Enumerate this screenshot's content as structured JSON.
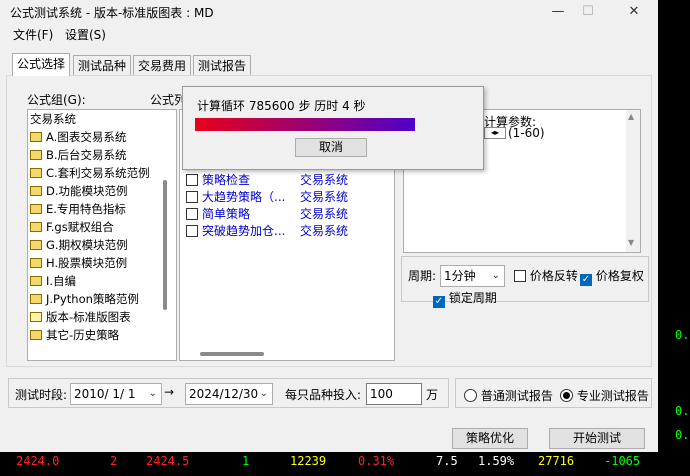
{
  "window": {
    "title": "公式测试系统 - 版本-标准版图表 : MD"
  },
  "menu": {
    "file": "文件(F)",
    "settings": "设置(S)"
  },
  "tabs": [
    "公式选择",
    "测试品种",
    "交易费用",
    "测试报告"
  ],
  "formula_group": {
    "label": "公式组(G):",
    "items": [
      "交易系统",
      "A.图表交易系统",
      "B.后台交易系统",
      "C.套利交易系统范例",
      "D.功能模块范例",
      "E.专用特色指标",
      "F.gs赋权组合",
      "G.期权模块范例",
      "H.股票模块范例",
      "I.自编",
      "J.Python策略范例",
      "版本-标准版图表",
      "其它-历史策略"
    ]
  },
  "formula_list": {
    "label": "公式列",
    "items": [
      {
        "name": "策略检查",
        "type": "交易系统"
      },
      {
        "name": "大趋势策略（...",
        "type": "交易系统"
      },
      {
        "name": "简单策略",
        "type": "交易系统"
      },
      {
        "name": "突破趋势加仓...",
        "type": "交易系统"
      }
    ]
  },
  "params": {
    "label": "计算参数:",
    "range": "(1-60)"
  },
  "period": {
    "label": "周期:",
    "value": "1分钟",
    "price_reverse": "价格反转",
    "price_restore": "价格复权",
    "lock_period": "锁定周期"
  },
  "progress": {
    "text": "计算循环 785600 步 历时 4 秒",
    "cancel": "取消",
    "gradient_start": "#e8001a",
    "gradient_end": "#4f00c8"
  },
  "test_period": {
    "label": "测试时段:",
    "start": "2010/ 1/ 1",
    "arrow": "→",
    "end": "2024/12/30",
    "invest_label": "每只品种投入:",
    "invest_value": "100",
    "unit": "万"
  },
  "report": {
    "normal": "普通测试报告",
    "pro": "专业测试报告"
  },
  "actions": {
    "optimize": "策略优化",
    "start": "开始测试"
  },
  "ticker": [
    "2424.0",
    "2",
    "2424.5",
    "1",
    "12239",
    "0.31%",
    "7.5",
    "1.59%",
    "27716",
    "-1065"
  ],
  "right_edge": [
    "0.",
    "0.",
    "0."
  ]
}
